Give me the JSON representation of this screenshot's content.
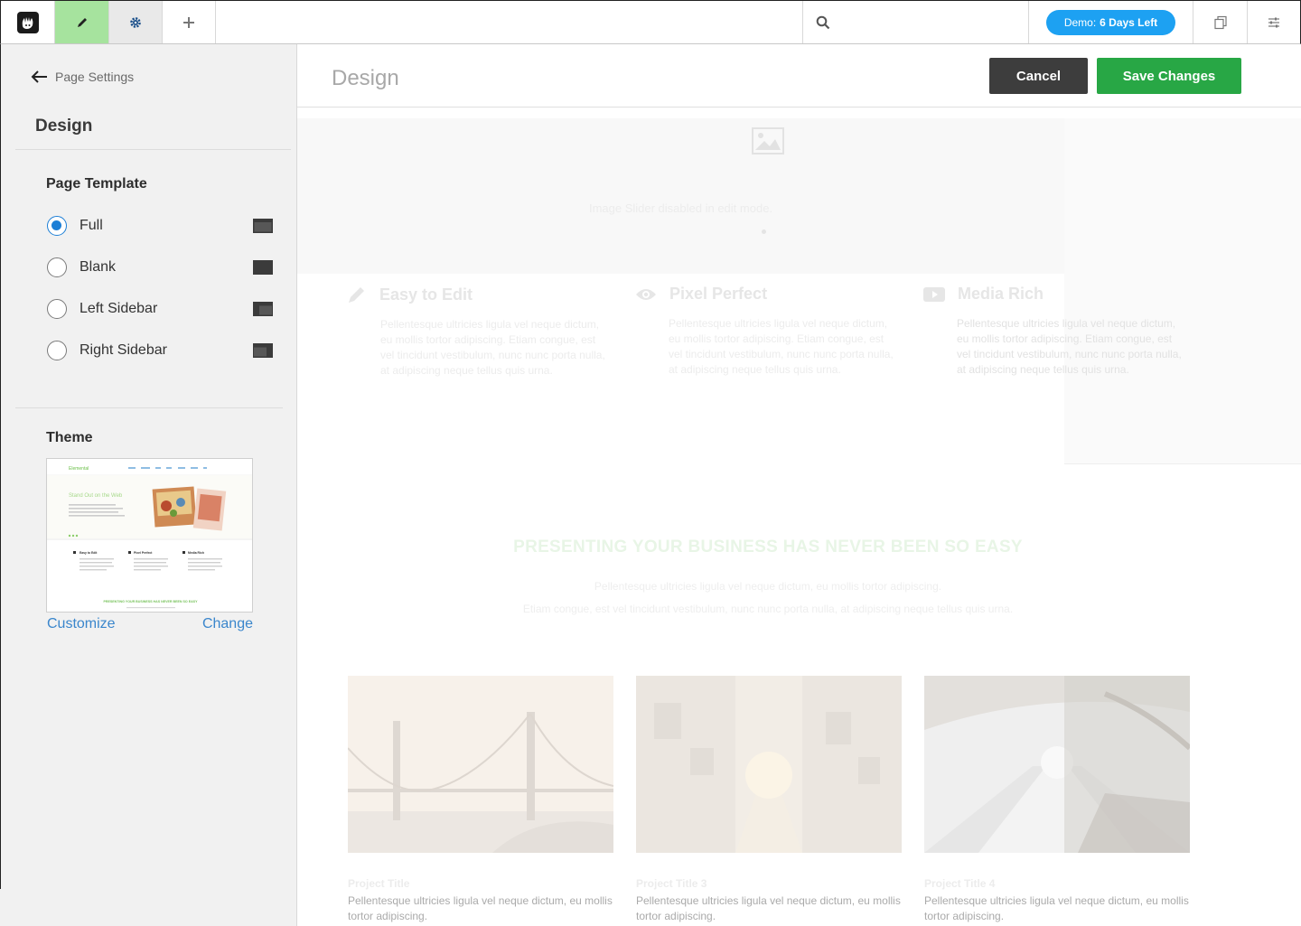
{
  "toolbar": {
    "demo_prefix": "Demo:",
    "demo_days": "6 Days Left",
    "icons": [
      "concrete-logo-icon",
      "pencil-icon",
      "gear-icon",
      "plus-icon",
      "search-icon",
      "pages-icon",
      "sliders-icon"
    ]
  },
  "panel": {
    "back_label": "Page Settings",
    "title": "Design",
    "page_template_label": "Page Template",
    "templates": [
      {
        "label": "Full",
        "selected": true
      },
      {
        "label": "Blank",
        "selected": false
      },
      {
        "label": "Left Sidebar",
        "selected": false
      },
      {
        "label": "Right Sidebar",
        "selected": false
      }
    ],
    "theme_label": "Theme",
    "customize_label": "Customize",
    "change_label": "Change",
    "theme_preview": {
      "brand": "Elemental",
      "tagline": "Stand Out on the Web",
      "features": [
        "Easy to Edit",
        "Pixel Perfect",
        "Media Rich"
      ],
      "banner": "PRESENTING YOUR BUSINESS HAS NEVER BEEN SO EASY"
    }
  },
  "main": {
    "title": "Design",
    "cancel_label": "Cancel",
    "save_label": "Save Changes",
    "hero_caption": "Image Slider disabled in edit mode.",
    "features": [
      {
        "title": "Easy to Edit",
        "icon": "pencil-icon",
        "text": "Pellentesque ultricies ligula vel neque dictum, eu mollis tortor adipiscing. Etiam congue, est vel tincidunt vestibulum, nunc nunc porta nulla, at adipiscing neque tellus quis urna."
      },
      {
        "title": "Pixel Perfect",
        "icon": "eye-icon",
        "text": "Pellentesque ultricies ligula vel neque dictum, eu mollis tortor adipiscing. Etiam congue, est vel tincidunt vestibulum, nunc nunc porta nulla, at adipiscing neque tellus quis urna."
      },
      {
        "title": "Media Rich",
        "icon": "video-icon",
        "text": "Pellentesque ultricies ligula vel neque dictum, eu mollis tortor adipiscing. Etiam congue, est vel tincidunt vestibulum, nunc nunc porta nulla, at adipiscing neque tellus quis urna."
      }
    ],
    "presenting_title": "PRESENTING YOUR BUSINESS HAS NEVER BEEN SO EASY",
    "presenting_line1": "Pellentesque ultricies ligula vel neque dictum, eu mollis tortor adipiscing.",
    "presenting_line2": "Etiam congue, est vel tincidunt vestibulum, nunc nunc porta nulla, at adipiscing neque tellus quis urna.",
    "projects": [
      {
        "title": "Project Title",
        "text": "Pellentesque ultricies ligula vel neque dictum, eu mollis tortor adipiscing."
      },
      {
        "title": "Project Title 3",
        "text": "Pellentesque ultricies ligula vel neque dictum, eu mollis tortor adipiscing."
      },
      {
        "title": "Project Title 4",
        "text": "Pellentesque ultricies ligula vel neque dictum, eu mollis tortor adipiscing."
      }
    ]
  },
  "colors": {
    "edit_active": "#a6e39e",
    "demo_blue": "#1da1f2",
    "save_green": "#28a745",
    "cancel_dark": "#3d3d3d",
    "link_blue": "#3a86cc",
    "radio_blue": "#1d7fd6"
  }
}
